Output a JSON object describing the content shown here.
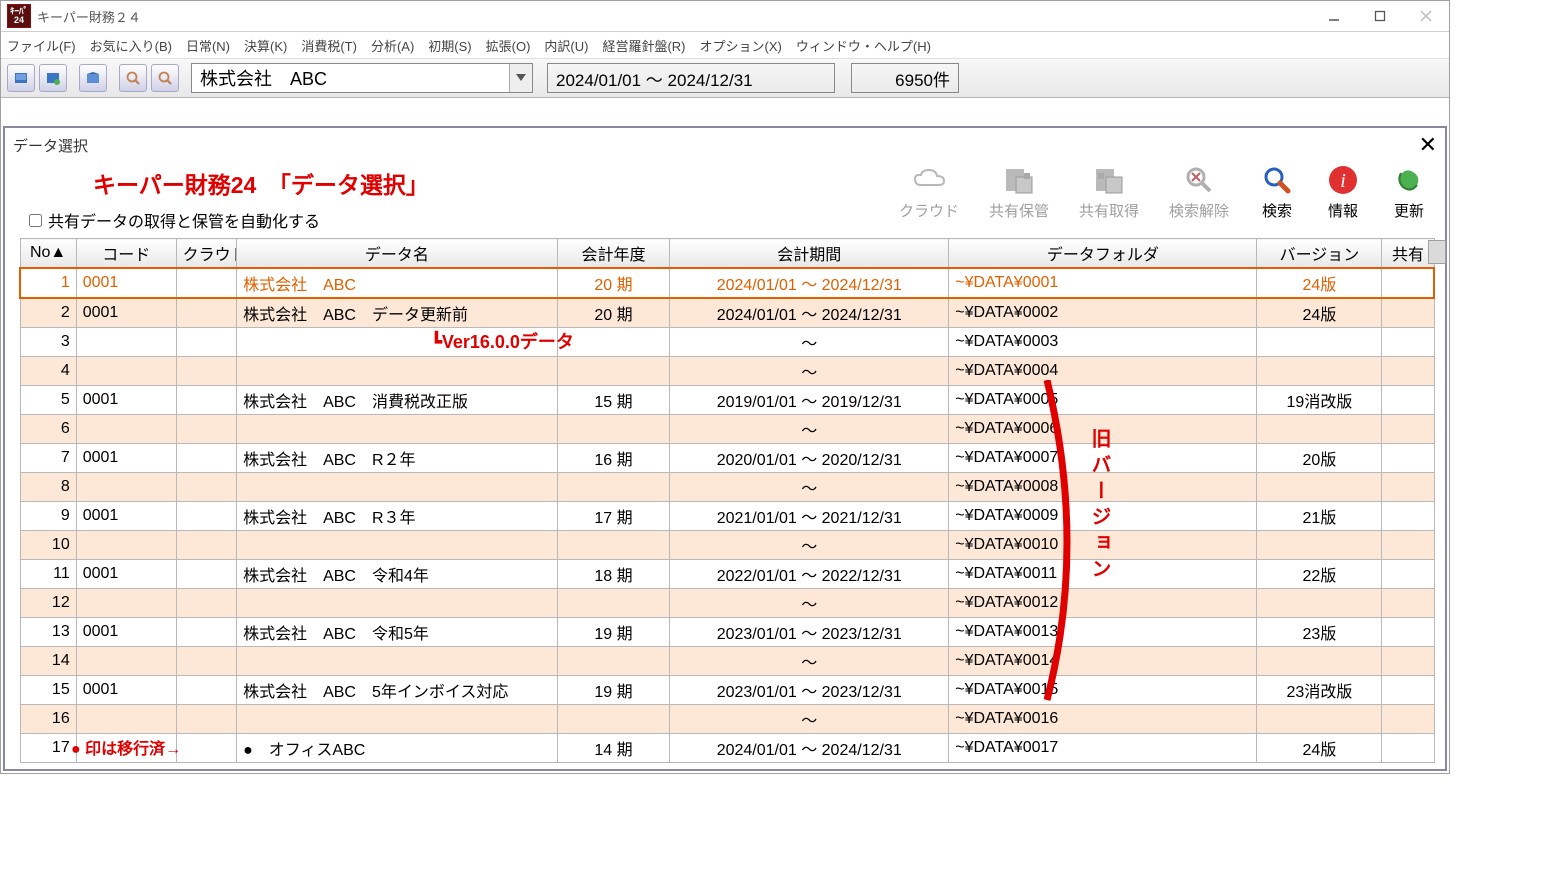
{
  "app": {
    "title": "キーパー財務２４"
  },
  "menubar": [
    "ファイル(F)",
    "お気に入り(B)",
    "日常(N)",
    "決算(K)",
    "消費税(T)",
    "分析(A)",
    "初期(S)",
    "拡張(O)",
    "内訳(U)",
    "経営羅針盤(R)",
    "オプション(X)",
    "ウィンドウ・ヘルプ(H)"
  ],
  "toolbar": {
    "company": "株式会社　ABC",
    "date_range": "2024/01/01 ～ 2024/12/31",
    "count": "6950件"
  },
  "panel": {
    "heading": "データ選択",
    "red_title": "キーパー財務24　「データ選択」",
    "checkbox_label": "共有データの取得と保管を自動化する",
    "actions": {
      "cloud": "クラウド",
      "share_save": "共有保管",
      "share_get": "共有取得",
      "clear_search": "検索解除",
      "search": "検索",
      "info": "情報",
      "refresh": "更新"
    }
  },
  "columns": {
    "no": "No▲",
    "code": "コード",
    "cloud": "クラウド",
    "name": "データ名",
    "year": "会計年度",
    "period": "会計期間",
    "folder": "データフォルダ",
    "version": "バージョン",
    "share": "共有"
  },
  "rows": [
    {
      "no": "1",
      "code": "0001",
      "name": "株式会社　ABC",
      "year": "20 期",
      "period": "2024/01/01 ～ 2024/12/31",
      "folder": "~¥DATA¥0001",
      "ver": "24版"
    },
    {
      "no": "2",
      "code": "0001",
      "name": "株式会社　ABC　データ更新前",
      "year": "20 期",
      "period": "2024/01/01 ～ 2024/12/31",
      "folder": "~¥DATA¥0002",
      "ver": "24版"
    },
    {
      "no": "3",
      "code": "",
      "name": "",
      "year": "",
      "period": "～",
      "folder": "~¥DATA¥0003",
      "ver": ""
    },
    {
      "no": "4",
      "code": "",
      "name": "",
      "year": "",
      "period": "～",
      "folder": "~¥DATA¥0004",
      "ver": ""
    },
    {
      "no": "5",
      "code": "0001",
      "name": "株式会社　ABC　消費税改正版",
      "year": "15 期",
      "period": "2019/01/01 ～ 2019/12/31",
      "folder": "~¥DATA¥0005",
      "ver": "19消改版"
    },
    {
      "no": "6",
      "code": "",
      "name": "",
      "year": "",
      "period": "～",
      "folder": "~¥DATA¥0006",
      "ver": ""
    },
    {
      "no": "7",
      "code": "0001",
      "name": "株式会社　ABC　R２年",
      "year": "16 期",
      "period": "2020/01/01 ～ 2020/12/31",
      "folder": "~¥DATA¥0007",
      "ver": "20版"
    },
    {
      "no": "8",
      "code": "",
      "name": "",
      "year": "",
      "period": "～",
      "folder": "~¥DATA¥0008",
      "ver": ""
    },
    {
      "no": "9",
      "code": "0001",
      "name": "株式会社　ABC　R３年",
      "year": "17 期",
      "period": "2021/01/01 ～ 2021/12/31",
      "folder": "~¥DATA¥0009",
      "ver": "21版"
    },
    {
      "no": "10",
      "code": "",
      "name": "",
      "year": "",
      "period": "～",
      "folder": "~¥DATA¥0010",
      "ver": ""
    },
    {
      "no": "11",
      "code": "0001",
      "name": "株式会社　ABC　令和4年",
      "year": "18 期",
      "period": "2022/01/01 ～ 2022/12/31",
      "folder": "~¥DATA¥0011",
      "ver": "22版"
    },
    {
      "no": "12",
      "code": "",
      "name": "",
      "year": "",
      "period": "～",
      "folder": "~¥DATA¥0012",
      "ver": ""
    },
    {
      "no": "13",
      "code": "0001",
      "name": "株式会社　ABC　令和5年",
      "year": "19 期",
      "period": "2023/01/01 ～ 2023/12/31",
      "folder": "~¥DATA¥0013",
      "ver": "23版"
    },
    {
      "no": "14",
      "code": "",
      "name": "",
      "year": "",
      "period": "～",
      "folder": "~¥DATA¥0014",
      "ver": ""
    },
    {
      "no": "15",
      "code": "0001",
      "name": "株式会社　ABC　5年インボイス対応",
      "year": "19 期",
      "period": "2023/01/01 ～ 2023/12/31",
      "folder": "~¥DATA¥0015",
      "ver": "23消改版"
    },
    {
      "no": "16",
      "code": "",
      "name": "",
      "year": "",
      "period": "～",
      "folder": "~¥DATA¥0016",
      "ver": ""
    },
    {
      "no": "17",
      "code": "",
      "name": "●　オフィスABC",
      "year": "14 期",
      "period": "2024/01/01 ～ 2024/12/31",
      "folder": "~¥DATA¥0017",
      "ver": "24版"
    }
  ],
  "annotations": {
    "ver_note": "Ver16.0.0データ",
    "old_ver": "旧バージョン",
    "migrated": "● 印は移行済→"
  }
}
